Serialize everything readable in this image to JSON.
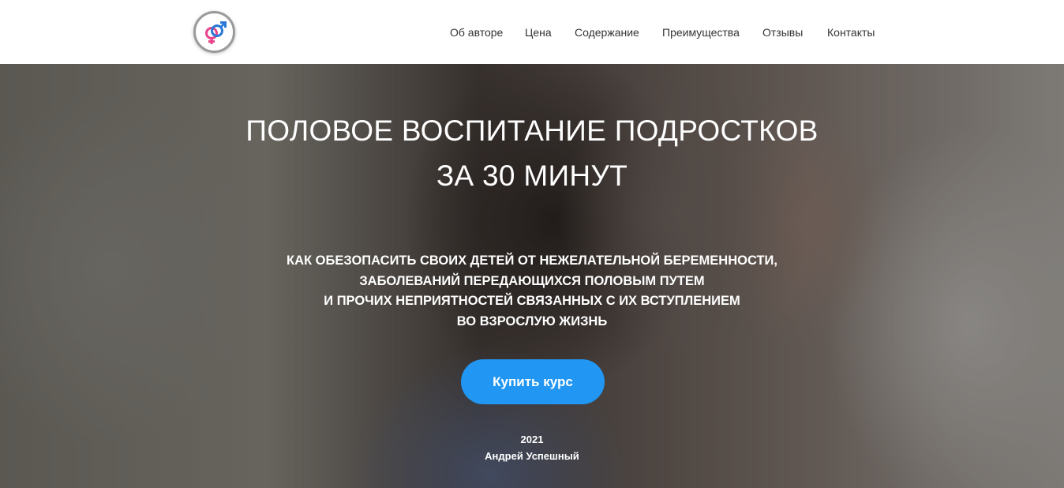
{
  "header": {
    "logo": {
      "icon": "gender-symbols-icon",
      "colors": {
        "female": "#e8438b",
        "male": "#2b78d6",
        "ring": "#9a9a9a"
      }
    },
    "nav": [
      {
        "label": "Об авторе"
      },
      {
        "label": "Цена"
      },
      {
        "label": "Содержание"
      },
      {
        "label": "Преимущества"
      },
      {
        "label": "Отзывы"
      },
      {
        "label": "Контакты"
      }
    ]
  },
  "hero": {
    "title_lines": [
      "ПОЛОВОЕ ВОСПИТАНИЕ ПОДРОСТКОВ",
      "ЗА 30 МИНУТ"
    ],
    "subtitle_lines": [
      "КАК ОБЕЗОПАСИТЬ СВОИХ ДЕТЕЙ ОТ НЕЖЕЛАТЕЛЬНОЙ БЕРЕМЕННОСТИ,",
      "ЗАБОЛЕВАНИЙ ПЕРЕДАЮЩИХСЯ ПОЛОВЫМ ПУТЕМ",
      "И ПРОЧИХ НЕПРИЯТНОСТЕЙ СВЯЗАННЫХ С ИХ ВСТУПЛЕНИЕМ",
      "ВО ВЗРОСЛУЮ ЖИЗНЬ"
    ],
    "cta_label": "Купить курс",
    "year": "2021",
    "author": "Андрей Успешный",
    "accent_color": "#2196f3"
  }
}
